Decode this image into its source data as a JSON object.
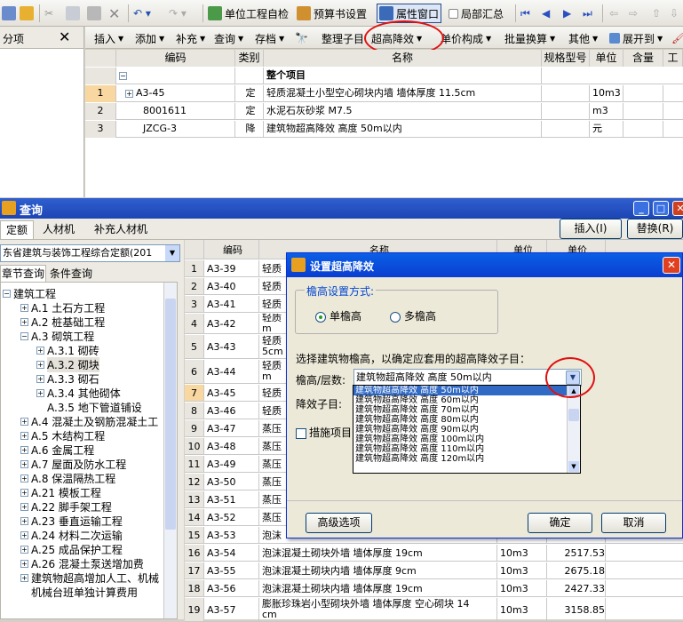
{
  "toolbar1": {
    "unit_check": "单位工程自检",
    "budget_settings": "预算书设置",
    "property_window": "属性窗口",
    "partial_summary": "局部汇总"
  },
  "left_panel": {
    "title": "分项",
    "close": "✕"
  },
  "toolbar2": {
    "insert": "插入",
    "add": "添加",
    "supplement": "补充",
    "query": "查询",
    "save": "存档",
    "organize": "整理子目",
    "high_rise": "超高降效",
    "unit_price": "单价构成",
    "batch_convert": "批量换算",
    "other": "其他",
    "expand_to": "展开到"
  },
  "grid1": {
    "headers": [
      "编码",
      "类别",
      "名称",
      "规格型号",
      "单位",
      "含量",
      "工"
    ],
    "section": "整个项目",
    "rows": [
      {
        "num": "1",
        "code": "A3-45",
        "type": "定",
        "name": "轻质混凝土小型空心砌块内墙 墙体厚度 11.5cm",
        "unit": "10m3"
      },
      {
        "num": "2",
        "code": "8001611",
        "type": "定",
        "name": "水泥石灰砂浆 M7.5",
        "unit": "m3"
      },
      {
        "num": "3",
        "code": "JZCG-3",
        "type": "降",
        "name": "建筑物超高降效 高度 50m以内",
        "unit": "元"
      }
    ]
  },
  "query_window": {
    "title": "查询",
    "tabs": [
      "定额",
      "人材机",
      "补充人材机"
    ],
    "insert_btn": "插入(I)",
    "replace_btn": "替换(R)",
    "db_select": "东省建筑与装饰工程综合定额(201",
    "subtabs": [
      "章节查询",
      "条件查询"
    ],
    "tree": [
      "建筑工程",
      "A.1 土石方工程",
      "A.2 桩基础工程",
      "A.3 砌筑工程",
      "A.3.1 砌砖",
      "A.3.2 砌块",
      "A.3.3 砌石",
      "A.3.4 其他砌体",
      "A.3.5 地下管道铺设",
      "A.4 混凝土及钢筋混凝土工",
      "A.5 木结构工程",
      "A.6 金属工程",
      "A.7 屋面及防水工程",
      "A.8 保温隔热工程",
      "A.21 模板工程",
      "A.22 脚手架工程",
      "A.23 垂直运输工程",
      "A.24 材料二次运输",
      "A.25 成品保护工程",
      "A.26 混凝土泵送增加费",
      "建筑物超高增加人工、机械",
      "机械台班单独计算费用"
    ],
    "grid_header_code": "编码",
    "grid_header_name": "名称",
    "grid_header_unit": "单位",
    "grid_header_price": "单价",
    "rows": [
      {
        "num": "1",
        "code": "A3-39",
        "name": "轻质",
        "unit": "",
        "price": ""
      },
      {
        "num": "2",
        "code": "A3-40",
        "name": "轻质",
        "unit": "",
        "price": ""
      },
      {
        "num": "3",
        "code": "A3-41",
        "name": "轻质",
        "unit": "",
        "price": ""
      },
      {
        "num": "4",
        "code": "A3-42",
        "name": "轻质",
        "name2": "m",
        "unit": "",
        "price": ""
      },
      {
        "num": "5",
        "code": "A3-43",
        "name": "轻质",
        "name2": "5cm",
        "unit": "",
        "price": ""
      },
      {
        "num": "6",
        "code": "A3-44",
        "name": "轻质",
        "name2": "m",
        "unit": "",
        "price": ""
      },
      {
        "num": "7",
        "code": "A3-45",
        "name": "轻质",
        "unit": "",
        "price": ""
      },
      {
        "num": "8",
        "code": "A3-46",
        "name": "轻质",
        "unit": "",
        "price": ""
      },
      {
        "num": "9",
        "code": "A3-47",
        "name": "蒸压",
        "unit": "",
        "price": ""
      },
      {
        "num": "10",
        "code": "A3-48",
        "name": "蒸压",
        "unit": "",
        "price": ""
      },
      {
        "num": "11",
        "code": "A3-49",
        "name": "蒸压",
        "unit": "",
        "price": ""
      },
      {
        "num": "12",
        "code": "A3-50",
        "name": "蒸压",
        "unit": "",
        "price": ""
      },
      {
        "num": "13",
        "code": "A3-51",
        "name": "蒸压",
        "unit": "",
        "price": ""
      },
      {
        "num": "14",
        "code": "A3-52",
        "name": "蒸压",
        "unit": "",
        "price": ""
      },
      {
        "num": "15",
        "code": "A3-53",
        "name": "泡沫",
        "unit": "",
        "price": ""
      },
      {
        "num": "16",
        "code": "A3-54",
        "name": "泡沫混凝土砌块外墙 墙体厚度 19cm",
        "unit": "10m3",
        "price": "2517.53"
      },
      {
        "num": "17",
        "code": "A3-55",
        "name": "泡沫混凝土砌块内墙 墙体厚度 9cm",
        "unit": "10m3",
        "price": "2675.18"
      },
      {
        "num": "18",
        "code": "A3-56",
        "name": "泡沫混凝土砌块内墙 墙体厚度 19cm",
        "unit": "10m3",
        "price": "2427.33"
      },
      {
        "num": "19",
        "code": "A3-57",
        "name": "膨胀珍珠岩小型砌块外墙 墙体厚度 空心砌块 14",
        "name2": "cm",
        "unit": "10m3",
        "price": "3158.85"
      }
    ]
  },
  "dialog": {
    "title": "设置超高降效",
    "group_label": "檐高设置方式:",
    "radio_single": "单檐高",
    "radio_multi": "多檐高",
    "instruction": "选择建筑物檐高，以确定应套用的超高降效子目：",
    "eave_label": "檐高/层数:",
    "eave_value": "建筑物超高降效 高度 50m以内",
    "reduce_label": "降效子目:",
    "measure_label": "措施项目",
    "options": [
      "建筑物超高降效 高度 50m以内",
      "建筑物超高降效 高度 60m以内",
      "建筑物超高降效 高度 70m以内",
      "建筑物超高降效 高度 80m以内",
      "建筑物超高降效 高度 90m以内",
      "建筑物超高降效 高度 100m以内",
      "建筑物超高降效 高度 110m以内",
      "建筑物超高降效 高度 120m以内"
    ],
    "advanced_btn": "高级选项",
    "ok_btn": "确定",
    "cancel_btn": "取消"
  }
}
